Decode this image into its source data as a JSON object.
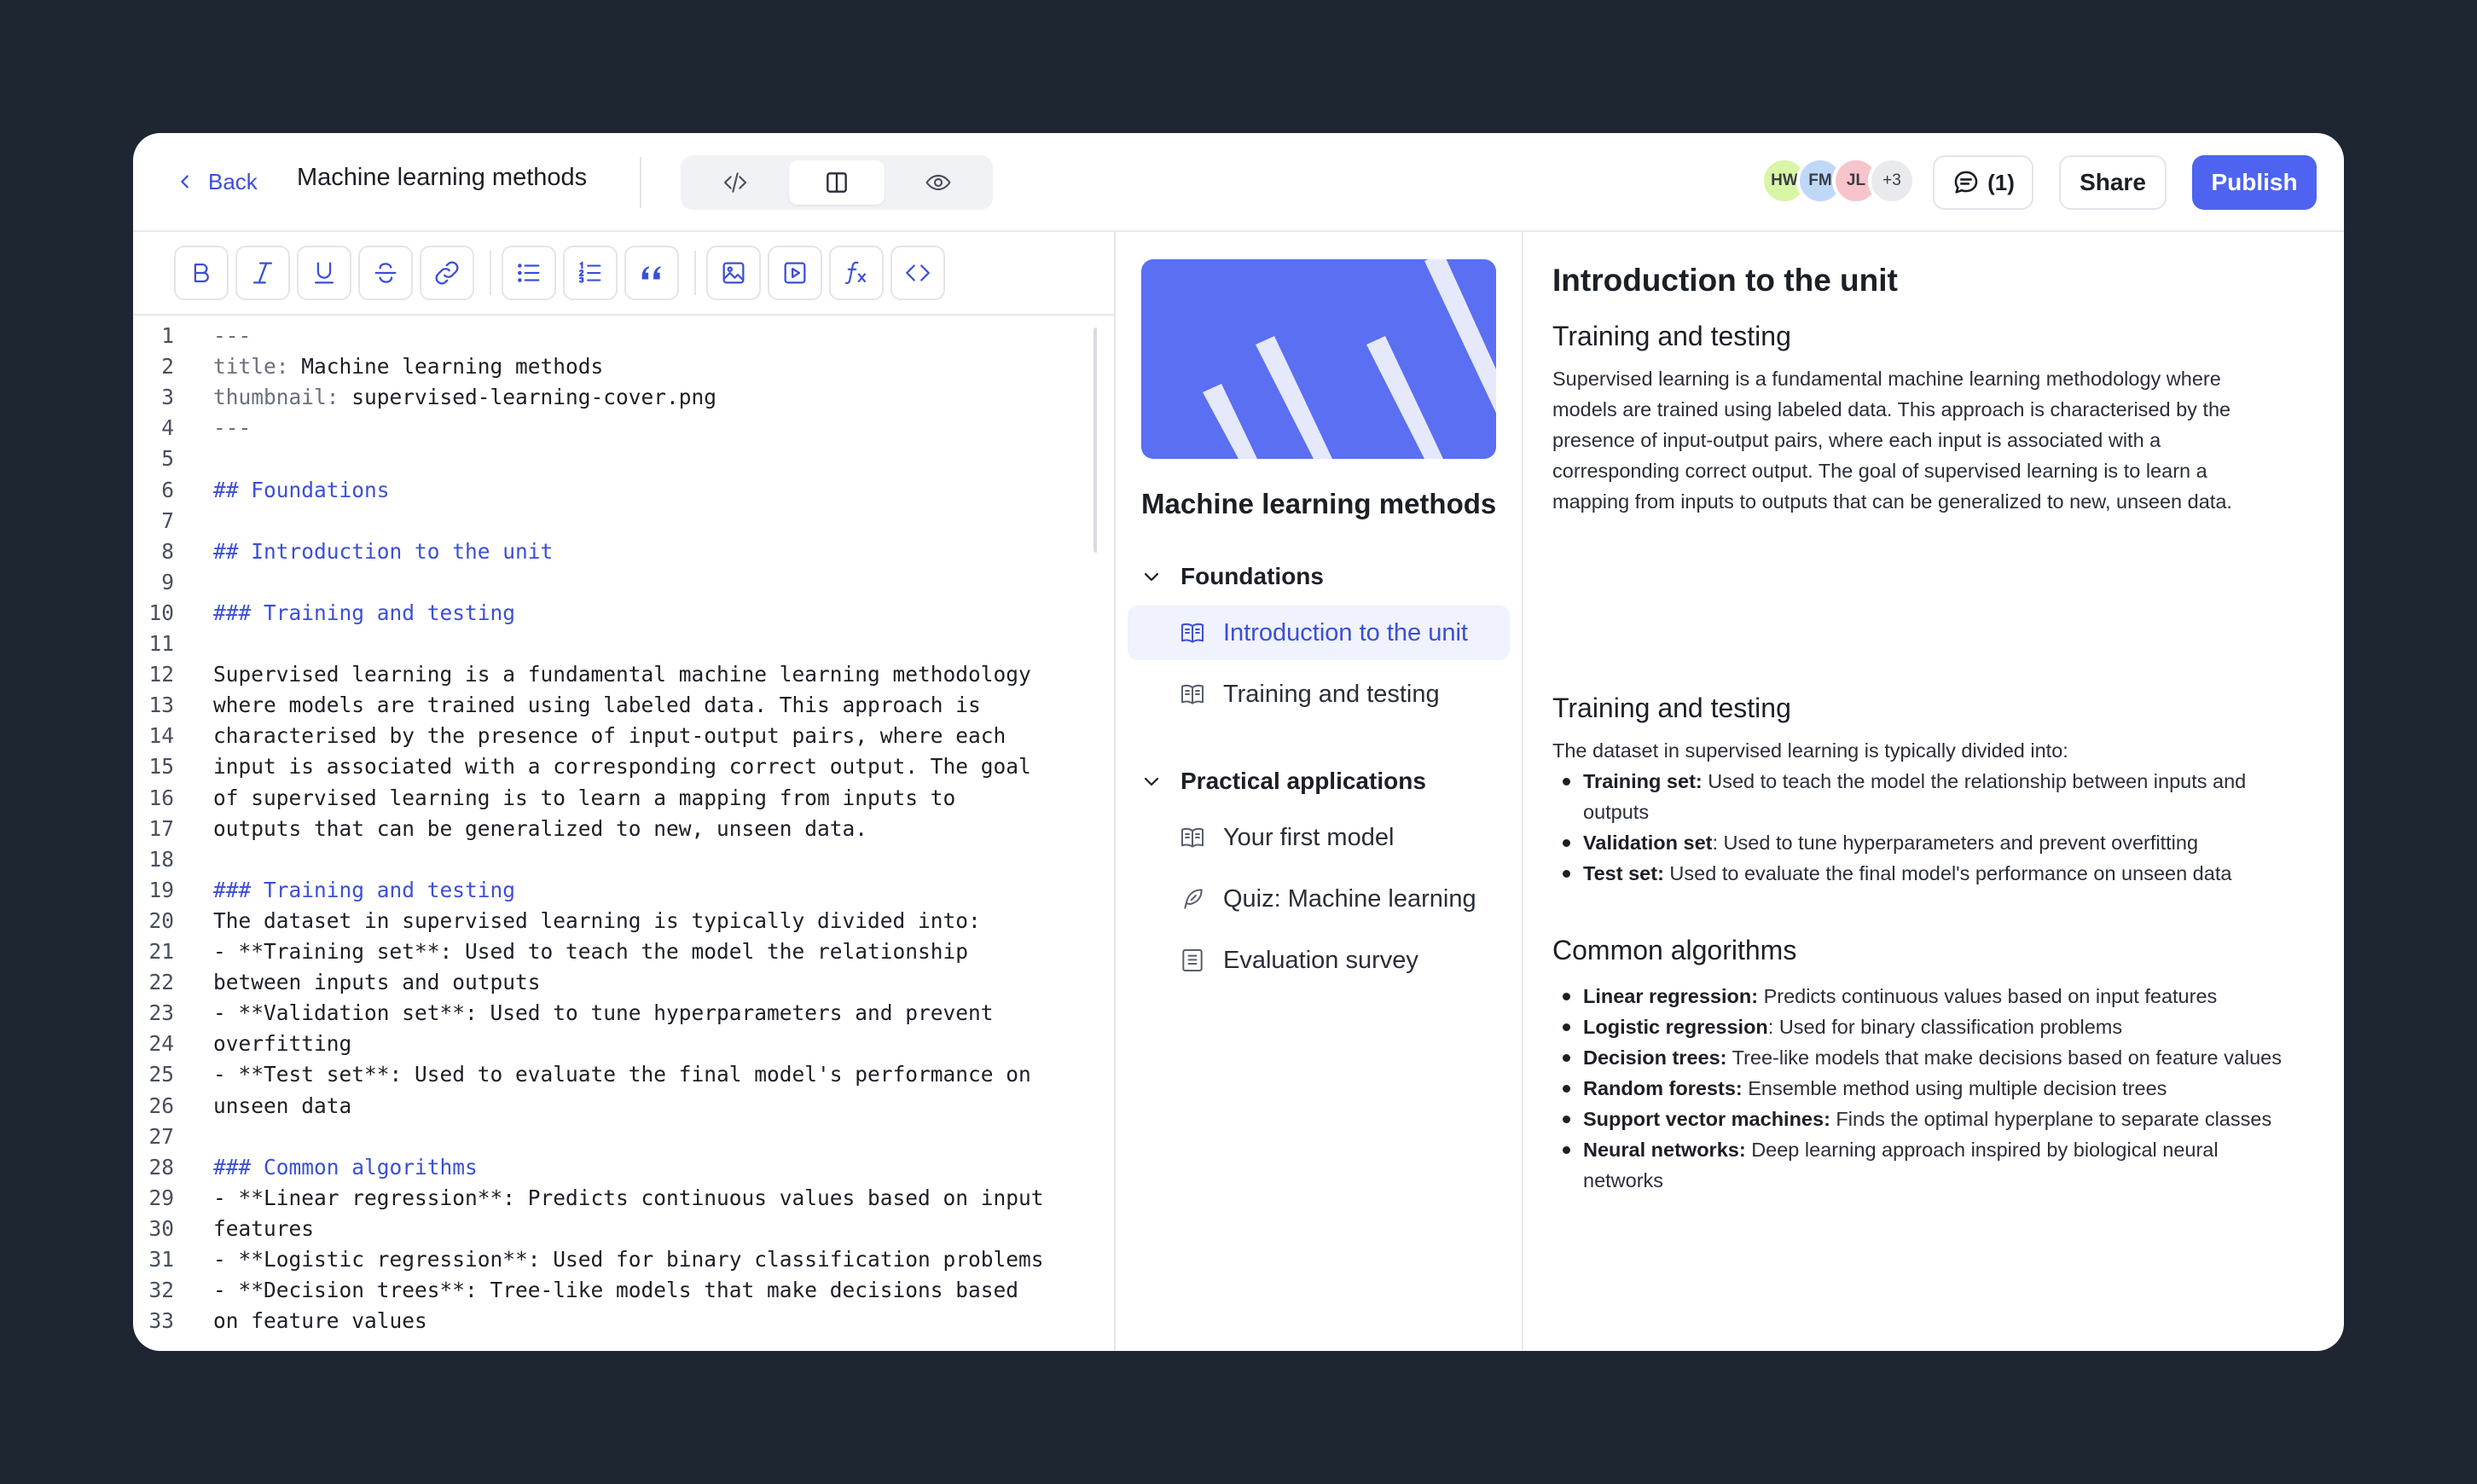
{
  "header": {
    "back_label": "Back",
    "title": "Machine learning methods",
    "view_modes": [
      "code-icon",
      "split-view-icon",
      "eye-icon"
    ],
    "avatars": [
      {
        "initials": "HW",
        "color": "#d9f5a6"
      },
      {
        "initials": "FM",
        "color": "#bfd8f8"
      },
      {
        "initials": "JL",
        "color": "#f8c4cb"
      },
      {
        "initials": "+3",
        "color": "#e9eaee"
      }
    ],
    "comments_label": "(1)",
    "share_label": "Share",
    "publish_label": "Publish",
    "accent": "#4e64f0"
  },
  "toolbar": {
    "buttons": [
      "bold-icon",
      "italic-icon",
      "underline-icon",
      "strikethrough-icon",
      "link-icon",
      "bullet-list-icon",
      "numbered-list-icon",
      "quote-icon",
      "image-icon",
      "video-icon",
      "formula-icon",
      "code-icon"
    ]
  },
  "editor": {
    "lines": [
      "---",
      "title: Machine learning methods",
      "thumbnail: supervised-learning-cover.png",
      "---",
      "",
      "## Foundations",
      "",
      "## Introduction to the unit",
      "",
      "### Training and testing",
      "",
      "Supervised learning is a fundamental machine learning methodology",
      "where models are trained using labeled data. This approach is",
      "characterised by the presence of input-output pairs, where each",
      "input is associated with a corresponding correct output. The goal",
      "of supervised learning is to learn a mapping from inputs to",
      "outputs that can be generalized to new, unseen data.",
      "",
      "### Training and testing",
      "The dataset in supervised learning is typically divided into:",
      "- **Training set**: Used to teach the model the relationship",
      "between inputs and outputs",
      "- **Validation set**: Used to tune hyperparameters and prevent",
      "overfitting",
      "- **Test set**: Used to evaluate the final model's performance on",
      "unseen data",
      "",
      "### Common algorithms",
      "- **Linear regression**: Predicts continuous values based on input",
      "features",
      "- **Logistic regression**: Used for binary classification problems",
      "- **Decision trees**: Tree-like models that make decisions based",
      "on feature values"
    ]
  },
  "outline": {
    "course_title": "Machine learning methods",
    "sections": [
      {
        "title": "Foundations",
        "items": [
          {
            "label": "Introduction to the unit",
            "icon": "book-icon",
            "active": true
          },
          {
            "label": "Training and testing",
            "icon": "book-icon",
            "active": false
          }
        ]
      },
      {
        "title": "Practical applications",
        "items": [
          {
            "label": "Your first model",
            "icon": "book-icon",
            "active": false
          },
          {
            "label": "Quiz: Machine learning",
            "icon": "quill-icon",
            "active": false
          },
          {
            "label": "Evaluation survey",
            "icon": "survey-icon",
            "active": false
          }
        ]
      }
    ]
  },
  "preview": {
    "h1": "Introduction to the unit",
    "h2_a": "Training and testing",
    "para_lines": [
      "Supervised learning is a fundamental machine learning methodology where",
      "models are trained using labeled data. This approach is characterised by the",
      "presence of input-output pairs, where each input is associated with a",
      "corresponding correct output. The goal of supervised learning is to learn a",
      "mapping from inputs to outputs that can be generalized to new, unseen data."
    ],
    "h2_b": "Training and testing",
    "intro": "The dataset in supervised learning is typically divided into:",
    "split_items": [
      {
        "term": "Training set:",
        "text": " Used to teach the model the relationship between inputs and",
        "cont": "outputs"
      },
      {
        "term": "Validation set",
        "text": ": Used to tune hyperparameters and prevent overfitting",
        "cont": ""
      },
      {
        "term": "Test set:",
        "text": " Used to evaluate the final model's performance on unseen data",
        "cont": ""
      }
    ],
    "h2_c": "Common algorithms",
    "algorithms": [
      {
        "term": "Linear regression:",
        "text": " Predicts continuous values based on input features",
        "cont": ""
      },
      {
        "term": "Logistic regression",
        "text": ": Used for binary classification problems",
        "cont": ""
      },
      {
        "term": "Decision trees:",
        "text": " Tree-like models that make decisions based on feature values",
        "cont": ""
      },
      {
        "term": "Random forests:",
        "text": " Ensemble method using multiple decision trees",
        "cont": ""
      },
      {
        "term": "Support vector machines:",
        "text": " Finds the optimal hyperplane to separate classes",
        "cont": ""
      },
      {
        "term": "Neural networks:",
        "text": " Deep learning approach inspired by biological neural",
        "cont": "networks"
      }
    ]
  }
}
